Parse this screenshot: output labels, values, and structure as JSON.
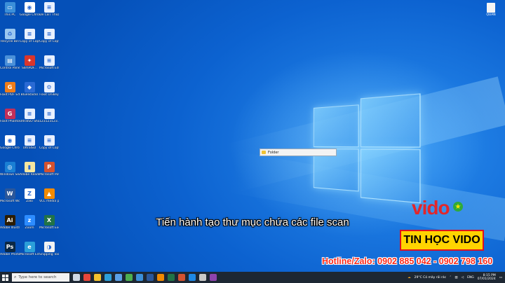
{
  "desktop_icons": [
    {
      "label": "This PC",
      "color": "#3b8fd9",
      "glyph": "▭",
      "name": "this-pc-icon",
      "col": 0,
      "row": 0
    },
    {
      "label": "Google Chrome",
      "color": "#ffffff",
      "glyph": "◉",
      "name": "chrome-icon",
      "col": 1,
      "row": 0
    },
    {
      "label": "Đề CBT ThiDL Nhân",
      "color": "#e8f0ff",
      "glyph": "≡",
      "name": "document-icon",
      "col": 2,
      "row": 0
    },
    {
      "label": "Recycle Bin",
      "color": "#9ac7f0",
      "glyph": "♻",
      "name": "recycle-bin-icon",
      "col": 0,
      "row": 1
    },
    {
      "label": "Copy of Copy of Ti...",
      "color": "#e8f0ff",
      "glyph": "≡",
      "name": "document-icon",
      "col": 1,
      "row": 1
    },
    {
      "label": "Copy of Copy of Ti...",
      "color": "#e8f0ff",
      "glyph": "≡",
      "name": "document-icon",
      "col": 2,
      "row": 1
    },
    {
      "label": "Control Panel",
      "color": "#4a90d9",
      "glyph": "▤",
      "name": "control-panel-icon",
      "col": 0,
      "row": 2
    },
    {
      "label": "SlimPDF...",
      "color": "#d9352b",
      "glyph": "✦",
      "name": "pdf-app-icon",
      "col": 1,
      "row": 2
    },
    {
      "label": "Microsoft Edge...",
      "color": "#e8f0ff",
      "glyph": "≡",
      "name": "document-icon",
      "col": 2,
      "row": 2
    },
    {
      "label": "Foxit PDF Editor",
      "color": "#f07d1a",
      "glyph": "G",
      "name": "foxit-icon",
      "col": 0,
      "row": 3
    },
    {
      "label": "BlueStacks",
      "color": "#2a6ad4",
      "glyph": "◆",
      "name": "app-icon",
      "col": 1,
      "row": 3
    },
    {
      "label": "Foxit Unikey",
      "color": "#e8f0ff",
      "glyph": "⚙",
      "name": "unikey-icon",
      "col": 2,
      "row": 3
    },
    {
      "label": "Foxit PhantomPDF",
      "color": "#c22f5a",
      "glyph": "G",
      "name": "phantompdf-icon",
      "col": 0,
      "row": 4
    },
    {
      "label": "UltraISO Shortcut",
      "color": "#e8f0ff",
      "glyph": "≡",
      "name": "document-icon",
      "col": 1,
      "row": 4
    },
    {
      "label": "123123123...",
      "color": "#e8f0ff",
      "glyph": "≡",
      "name": "document-icon",
      "col": 2,
      "row": 4
    },
    {
      "label": "Google Chrome",
      "color": "#ffffff",
      "glyph": "◉",
      "name": "chrome-icon",
      "col": 0,
      "row": 5
    },
    {
      "label": "UltraISO",
      "color": "#e8f0ff",
      "glyph": "≡",
      "name": "document-icon",
      "col": 1,
      "row": 5
    },
    {
      "label": "Copy of Copy of Ti...",
      "color": "#e8f0ff",
      "glyph": "≡",
      "name": "document-icon",
      "col": 2,
      "row": 5
    },
    {
      "label": "Windows Security",
      "color": "#1a7fd4",
      "glyph": "◎",
      "name": "security-icon",
      "col": 0,
      "row": 6
    },
    {
      "label": "Adobe Reader",
      "color": "#f5e6a0",
      "glyph": "▮",
      "name": "reader-icon",
      "col": 1,
      "row": 6
    },
    {
      "label": "Microsoft PowerPoint",
      "color": "#d35230",
      "glyph": "P",
      "name": "powerpoint-icon",
      "col": 2,
      "row": 6
    },
    {
      "label": "Microsoft Word 2016",
      "color": "#2b579a",
      "glyph": "W",
      "name": "word-icon",
      "col": 0,
      "row": 7
    },
    {
      "label": "Zalo",
      "color": "#ffffff",
      "glyph": "Z",
      "name": "zalo-icon",
      "col": 1,
      "row": 7
    },
    {
      "label": "VLC media player",
      "color": "#f18a00",
      "glyph": "▲",
      "name": "vlc-icon",
      "col": 2,
      "row": 7
    },
    {
      "label": "Adobe Illustrator",
      "color": "#2d1d00",
      "glyph": "Ai",
      "name": "illustrator-icon",
      "col": 0,
      "row": 8
    },
    {
      "label": "Zoom",
      "color": "#2d8cff",
      "glyph": "z",
      "name": "zoom-icon",
      "col": 1,
      "row": 8
    },
    {
      "label": "Microsoft Excel 2016",
      "color": "#217346",
      "glyph": "X",
      "name": "excel-icon",
      "col": 2,
      "row": 8
    },
    {
      "label": "Adobe Photoshop",
      "color": "#0b2845",
      "glyph": "Ps",
      "name": "photoshop-icon",
      "col": 0,
      "row": 9
    },
    {
      "label": "Microsoft Edge",
      "color": "#2b9fd9",
      "glyph": "e",
      "name": "edge-icon",
      "col": 1,
      "row": 9
    },
    {
      "label": "Snipping Tool",
      "color": "#f2f2f2",
      "glyph": "◑",
      "name": "snipping-icon",
      "col": 2,
      "row": 9
    }
  ],
  "right_icon": {
    "label": "QUAN"
  },
  "rename_box": {
    "value": "Folder"
  },
  "subtitle": "Tiến hành tạo thư mục chứa các file scan",
  "brand": {
    "logo": "vido",
    "box": "TIN HỌC VIDO",
    "hotline": "Hotline/Zalo: 0902 885 042 - 0902 798 160"
  },
  "taskbar": {
    "search_placeholder": "Type here to search",
    "apps": [
      {
        "name": "task-view-icon",
        "color": "#cfd8e3"
      },
      {
        "name": "chrome-taskbar-icon",
        "color": "#e8463a"
      },
      {
        "name": "file-explorer-icon",
        "color": "#f2c12e"
      },
      {
        "name": "edge-taskbar-icon",
        "color": "#2b9fd9"
      },
      {
        "name": "store-icon",
        "color": "#5aa0e6"
      },
      {
        "name": "chrome-taskbar-icon-2",
        "color": "#4caf50"
      },
      {
        "name": "edge-taskbar-icon-2",
        "color": "#3b8fd9"
      },
      {
        "name": "word-taskbar-icon",
        "color": "#2b579a"
      },
      {
        "name": "vlc-taskbar-icon",
        "color": "#f18a00"
      },
      {
        "name": "excel-taskbar-icon",
        "color": "#217346"
      },
      {
        "name": "powerpoint-taskbar-icon",
        "color": "#d35230"
      },
      {
        "name": "zalo-taskbar-icon",
        "color": "#1e88e5"
      },
      {
        "name": "snipping-taskbar-icon",
        "color": "#c9c9c9"
      },
      {
        "name": "app-taskbar-icon",
        "color": "#8e44ad"
      }
    ],
    "weather": "29°C  Có mây rải rác",
    "language": "ENG",
    "time": "8:15 PM",
    "date": "07/01/2024"
  }
}
